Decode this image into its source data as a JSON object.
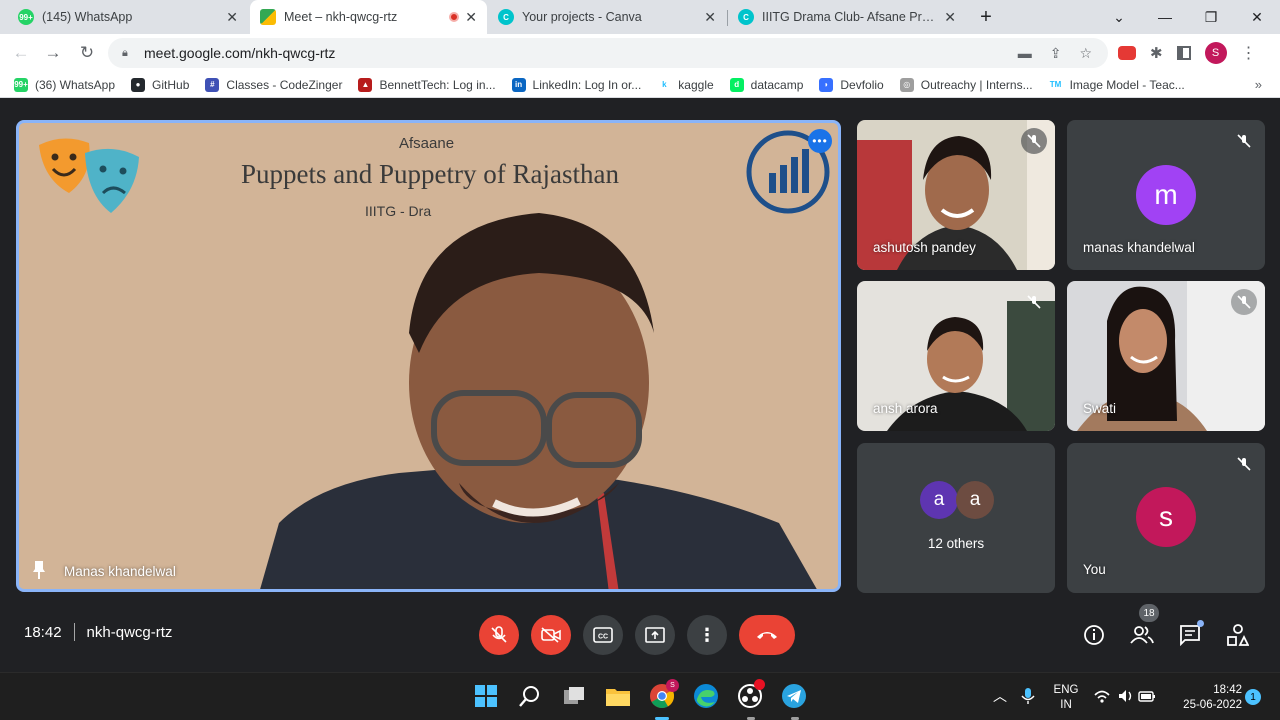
{
  "browser": {
    "tabs": [
      {
        "title": "(145) WhatsApp",
        "badge": "99+"
      },
      {
        "title": "Meet – nkh-qwcg-rtz"
      },
      {
        "title": "Your projects - Canva"
      },
      {
        "title": "IIITG Drama Club- Afsane Present"
      }
    ],
    "url": "meet.google.com/nkh-qwcg-rtz",
    "profile_initial": "S"
  },
  "bookmarks": [
    {
      "label": "(36) WhatsApp",
      "color": "#25d366",
      "glyph": "99+"
    },
    {
      "label": "GitHub",
      "color": "#24292e",
      "glyph": "●"
    },
    {
      "label": "Classes - CodeZinger",
      "color": "#3f51b5",
      "glyph": "#"
    },
    {
      "label": "BennettTech: Log in...",
      "color": "#b71c1c",
      "glyph": "▲"
    },
    {
      "label": "LinkedIn: Log In or...",
      "color": "#0a66c2",
      "glyph": "in"
    },
    {
      "label": "kaggle",
      "color": "#ffffff",
      "glyph": "k"
    },
    {
      "label": "datacamp",
      "color": "#03ef62",
      "glyph": "d"
    },
    {
      "label": "Devfolio",
      "color": "#3770ff",
      "glyph": "◗"
    },
    {
      "label": "Outreachy | Interns...",
      "color": "#9e9e9e",
      "glyph": "◎"
    },
    {
      "label": "Image Model - Teac...",
      "color": "#ffffff",
      "glyph": "TM"
    }
  ],
  "main_tile": {
    "slide_small": "Afsaane",
    "slide_title": "Puppets and Puppetry of Rajasthan",
    "slide_sub": "IIITG - Dra",
    "speaker": "Manas khandelwal"
  },
  "participants": [
    {
      "name": "ashutosh pandey"
    },
    {
      "name": "manas khandelwal",
      "initial": "m",
      "color": "#9334e6"
    },
    {
      "name": "ansh arora"
    },
    {
      "name": "Swati"
    },
    {
      "others_text": "12 others",
      "initials": [
        "a",
        "a"
      ]
    },
    {
      "name": "You",
      "initial": "s",
      "color": "#c2185b"
    }
  ],
  "call": {
    "time": "18:42",
    "code": "nkh-qwcg-rtz",
    "people_count": "18"
  },
  "taskbar": {
    "lang": "ENG",
    "region": "IN",
    "time": "18:42",
    "date": "25-06-2022",
    "notifications": "1",
    "chrome_badge": "S"
  }
}
